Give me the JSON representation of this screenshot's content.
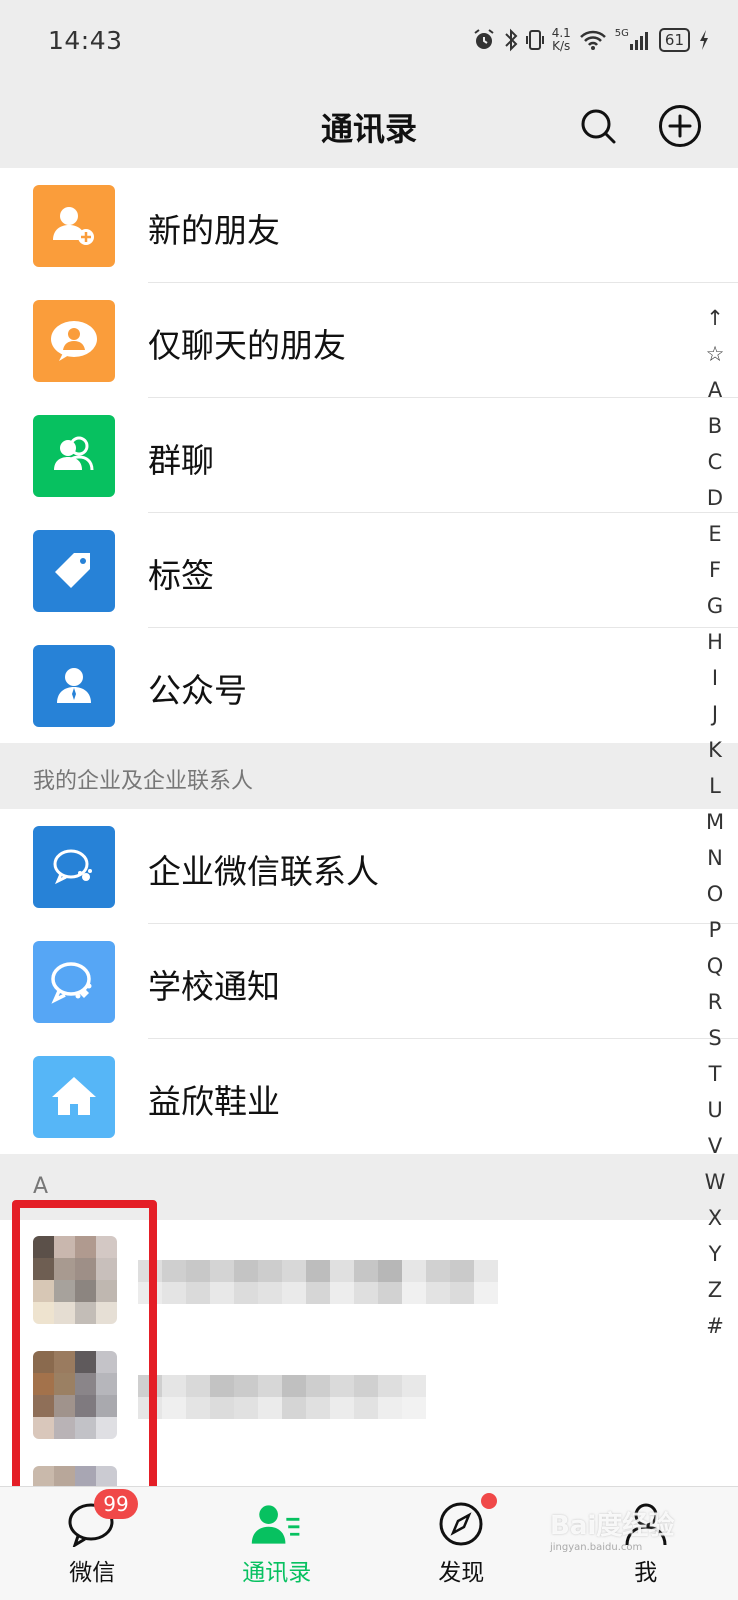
{
  "status_bar": {
    "time": "14:43",
    "speed_value": "4.1",
    "speed_unit": "K/s",
    "network": "5G",
    "battery": "61"
  },
  "nav": {
    "title": "通讯录",
    "search_icon": "search-icon",
    "add_icon": "add-circle-icon"
  },
  "top_items": [
    {
      "label": "新的朋友",
      "icon": "new-friend-icon",
      "color": "#fa9d3b"
    },
    {
      "label": "仅聊天的朋友",
      "icon": "chat-only-friend-icon",
      "color": "#fa9d3b"
    },
    {
      "label": "群聊",
      "icon": "group-chat-icon",
      "color": "#07c160"
    },
    {
      "label": "标签",
      "icon": "tag-icon",
      "color": "#2782d7"
    },
    {
      "label": "公众号",
      "icon": "official-account-icon",
      "color": "#2782d7"
    }
  ],
  "enterprise_section": {
    "header": "我的企业及企业联系人",
    "items": [
      {
        "label": "企业微信联系人",
        "icon": "work-wechat-icon",
        "color": "#2782d7"
      },
      {
        "label": "学校通知",
        "icon": "school-notice-icon",
        "color": "#56a6f5"
      },
      {
        "label": "益欣鞋业",
        "icon": "home-icon",
        "color": "#56b6f7"
      }
    ]
  },
  "contacts_section": {
    "header": "A"
  },
  "index_bar": [
    "↑",
    "☆",
    "A",
    "B",
    "C",
    "D",
    "E",
    "F",
    "G",
    "H",
    "I",
    "J",
    "K",
    "L",
    "M",
    "N",
    "O",
    "P",
    "Q",
    "R",
    "S",
    "T",
    "U",
    "V",
    "W",
    "X",
    "Y",
    "Z",
    "#"
  ],
  "tabs": [
    {
      "label": "微信",
      "icon": "chat-bubble-icon",
      "badge": "99",
      "active": false
    },
    {
      "label": "通讯录",
      "icon": "contacts-icon",
      "active": true
    },
    {
      "label": "发现",
      "icon": "compass-icon",
      "active": false
    },
    {
      "label": "我",
      "icon": "person-icon",
      "active": false
    }
  ],
  "watermark": {
    "brand": "Bai度经验",
    "url": "jingyan.baidu.com"
  },
  "colors": {
    "accent": "#07c160",
    "highlight_box": "#e41e26",
    "badge": "#f04848",
    "background": "#ededed"
  }
}
